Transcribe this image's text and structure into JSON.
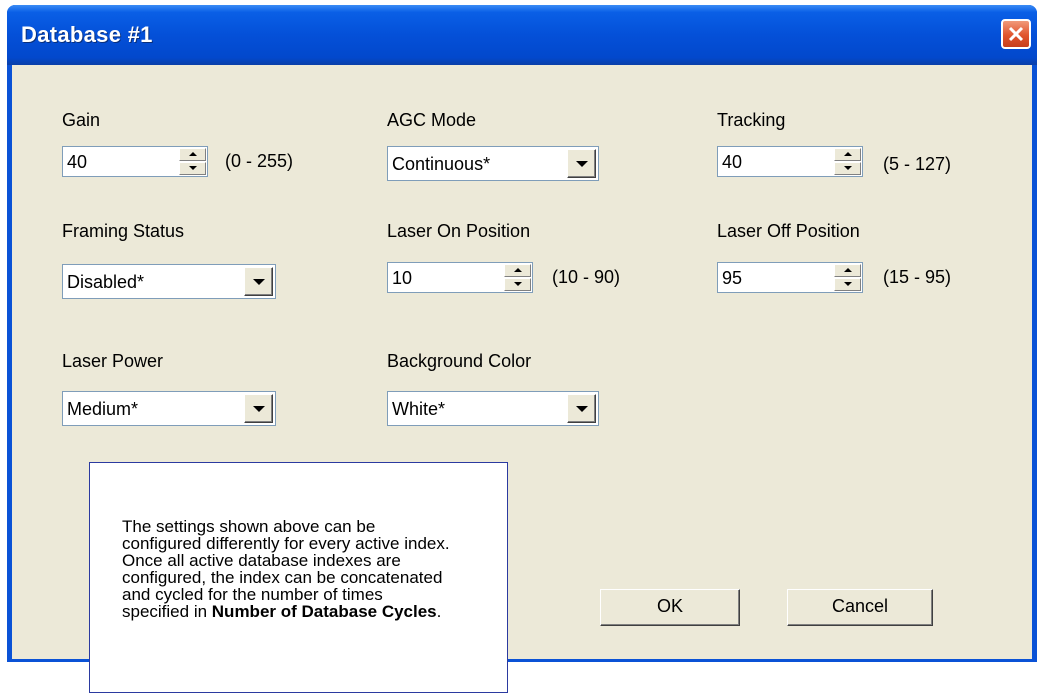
{
  "window": {
    "title": "Database #1",
    "close_label": "close"
  },
  "fields": {
    "gain": {
      "label": "Gain",
      "value": "40",
      "range": "(0 - 255)"
    },
    "agc_mode": {
      "label": "AGC Mode",
      "value": "Continuous*"
    },
    "tracking": {
      "label": "Tracking",
      "value": "40",
      "range": "(5 - 127)"
    },
    "framing_status": {
      "label": "Framing Status",
      "value": "Disabled*"
    },
    "laser_on": {
      "label": "Laser On Position",
      "value": "10",
      "range": "(10 - 90)"
    },
    "laser_off": {
      "label": "Laser Off Position",
      "value": "95",
      "range": "(15 - 95)"
    },
    "laser_power": {
      "label": "Laser Power",
      "value": "Medium*"
    },
    "background_color": {
      "label": "Background Color",
      "value": "White*"
    }
  },
  "buttons": {
    "ok": "OK",
    "cancel": "Cancel"
  },
  "callout": {
    "text": "The settings shown above can be configured differently for every active index. Once all active database indexes are configured, the index can be concatenated and cycled for the number of times specified in ",
    "bold": "Number of Database Cycles",
    "end": "."
  },
  "colors": {
    "titlebar": "#0450d8",
    "client": "#ece9d8",
    "close_button": "#e0542d",
    "callout_border": "#2b3aa0"
  },
  "icons": [
    "close-icon",
    "spin-up-icon",
    "spin-down-icon",
    "dropdown-arrow-icon"
  ]
}
